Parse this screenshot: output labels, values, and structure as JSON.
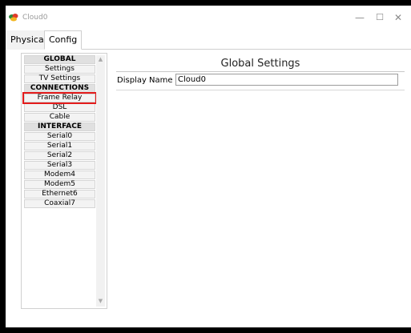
{
  "window": {
    "title": "Cloud0",
    "minimize_glyph": "—",
    "maximize_glyph": "☐",
    "close_glyph": "✕"
  },
  "tabs": [
    {
      "label": "Physical"
    },
    {
      "label": "Config"
    }
  ],
  "sidebar": {
    "items": [
      {
        "label": "GLOBAL",
        "type": "header"
      },
      {
        "label": "Settings",
        "type": "item"
      },
      {
        "label": "TV Settings",
        "type": "item"
      },
      {
        "label": "CONNECTIONS",
        "type": "header"
      },
      {
        "label": "Frame Relay",
        "type": "item",
        "selected": true
      },
      {
        "label": "DSL",
        "type": "item"
      },
      {
        "label": "Cable",
        "type": "item"
      },
      {
        "label": "INTERFACE",
        "type": "header"
      },
      {
        "label": "Serial0",
        "type": "item"
      },
      {
        "label": "Serial1",
        "type": "item"
      },
      {
        "label": "Serial2",
        "type": "item"
      },
      {
        "label": "Serial3",
        "type": "item"
      },
      {
        "label": "Modem4",
        "type": "item"
      },
      {
        "label": "Modem5",
        "type": "item"
      },
      {
        "label": "Ethernet6",
        "type": "item"
      },
      {
        "label": "Coaxial7",
        "type": "item"
      }
    ],
    "scroll_up_glyph": "▲",
    "scroll_down_glyph": "▼"
  },
  "main": {
    "section_title": "Global Settings",
    "display_name": {
      "label": "Display Name",
      "value": "Cloud0"
    }
  },
  "colors": {
    "highlight": "#e31b1b",
    "header_bg": "#e0e0e0",
    "item_bg": "#f3f3f3"
  }
}
